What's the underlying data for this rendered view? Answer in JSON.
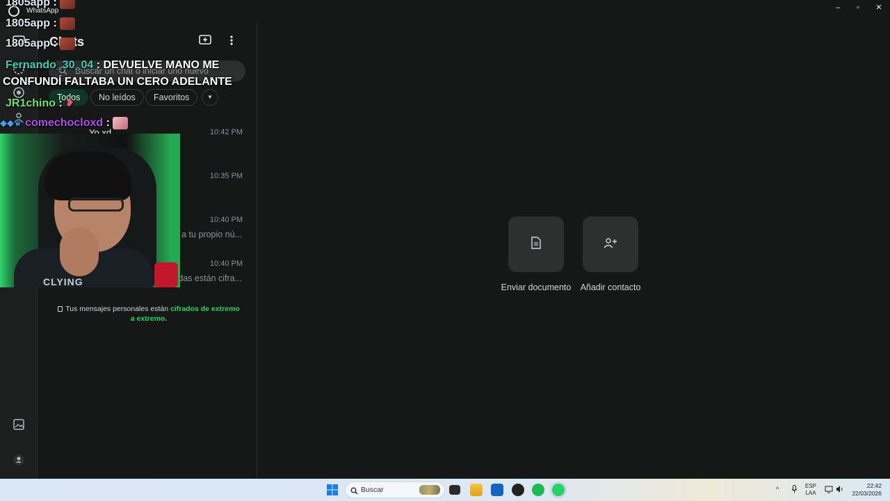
{
  "window": {
    "title": "WhatsApp",
    "controls": [
      "–",
      "▫",
      "✕"
    ]
  },
  "rail": {
    "icons": [
      "chats-icon",
      "status-icon",
      "channels-icon",
      "communities-icon",
      "media-icon",
      "profile-icon"
    ]
  },
  "chatlist": {
    "title": "Chats",
    "search_placeholder": "Buscar un chat o iniciar uno nuevo",
    "filters": [
      "Todos",
      "No leídos",
      "Favoritos"
    ],
    "rows": [
      {
        "name": "Yo xd",
        "time": "10:42 PM",
        "preview": ""
      },
      {
        "name": "",
        "time": "10:35 PM",
        "preview": ""
      },
      {
        "name": "",
        "time": "10:40 PM",
        "preview": "a tu propio nú..."
      },
      {
        "name": "",
        "time": "10:40 PM",
        "preview": "das están cifra..."
      }
    ],
    "e2e_text": "Tus mensajes personales están ",
    "e2e_link": "cifrados de extremo a extremo",
    "e2e_end": "."
  },
  "main": {
    "actions": [
      {
        "label": "Enviar documento",
        "icon": "document-icon"
      },
      {
        "label": "Añadir contacto",
        "icon": "add-contact-icon"
      }
    ]
  },
  "overlay": {
    "lines": [
      {
        "user": "1805app",
        "sep": " :",
        "msg": "",
        "color": "#dfe6f0"
      },
      {
        "user": "1805app",
        "sep": " :",
        "msg": "",
        "color": "#dfe6f0"
      },
      {
        "user": "1805app",
        "sep": " :",
        "msg": "",
        "color": "#dfe6f0"
      },
      {
        "user": "Fernando_30_04",
        "sep": " : ",
        "msg": "DEVUELVE MANO ME",
        "color": "#3fd0b4"
      },
      {
        "user": "",
        "sep": "",
        "msg": "CONFUNDÍ FALTABA UN CERO ADELANTE",
        "color": "#ffffff"
      },
      {
        "user": "JR1chino",
        "sep": " :",
        "msg": "",
        "color": "#6fe36b"
      },
      {
        "user": "comechocloxd",
        "sep": " :",
        "msg": "",
        "color": "#b04df0"
      }
    ],
    "webcam_text": "CLYING"
  },
  "taskbar": {
    "search_label": "Buscar",
    "lang_top": "ESP",
    "lang_bottom": "LAA",
    "time": "22:42",
    "date": "22/03/2026"
  }
}
